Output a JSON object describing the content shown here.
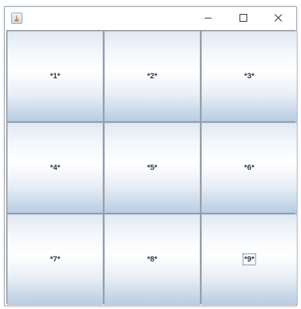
{
  "window": {
    "title": "",
    "controls": {
      "minimize": "minimize-icon",
      "maximize": "maximize-icon",
      "close": "close-icon"
    }
  },
  "grid": {
    "buttons": [
      {
        "label": "*1*",
        "focused": false
      },
      {
        "label": "*2*",
        "focused": false
      },
      {
        "label": "*3*",
        "focused": false
      },
      {
        "label": "*4*",
        "focused": false
      },
      {
        "label": "*5*",
        "focused": false
      },
      {
        "label": "*6*",
        "focused": false
      },
      {
        "label": "*7*",
        "focused": false
      },
      {
        "label": "*8*",
        "focused": false
      },
      {
        "label": "*9*",
        "focused": true
      }
    ]
  },
  "colors": {
    "button_gradient_top": "#dfe8f2",
    "button_gradient_bottom": "#b9cde3",
    "grid_border": "#8a8f95",
    "label_text": "#333a42"
  }
}
